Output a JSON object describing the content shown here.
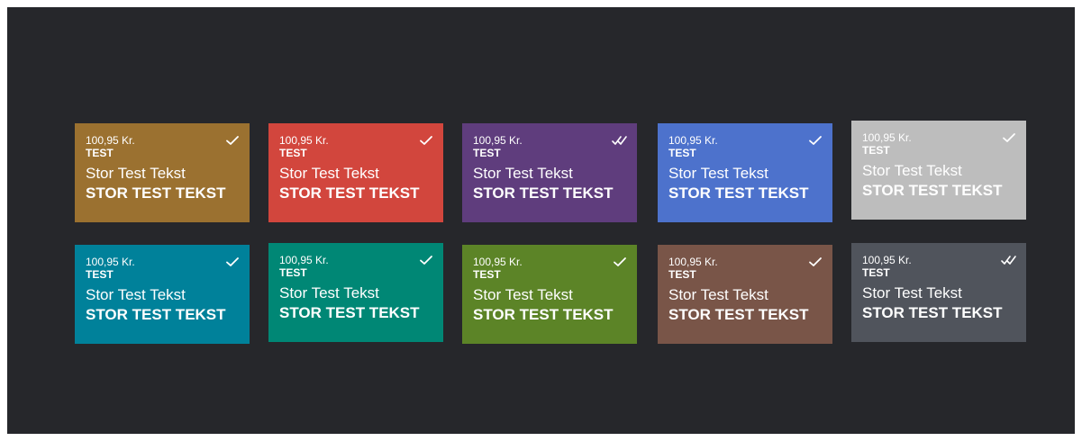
{
  "cards": [
    {
      "price": "100,95 Kr.",
      "label": "TEST",
      "text": "Stor Test Tekst",
      "text_bold": "STOR TEST TEKST",
      "color": "#9b7130",
      "icon": "check-icon"
    },
    {
      "price": "100,95 Kr.",
      "label": "TEST",
      "text": "Stor Test Tekst",
      "text_bold": "STOR TEST TEKST",
      "color": "#d2463d",
      "icon": "check-icon"
    },
    {
      "price": "100,95 Kr.",
      "label": "TEST",
      "text": "Stor Test Tekst",
      "text_bold": "STOR TEST TEKST",
      "color": "#5f3d7d",
      "icon": "double-check-icon"
    },
    {
      "price": "100,95 Kr.",
      "label": "TEST",
      "text": "Stor Test Tekst",
      "text_bold": "STOR TEST TEKST",
      "color": "#4d72cc",
      "icon": "check-icon"
    },
    {
      "price": "100,95 Kr.",
      "label": "TEST",
      "text": "Stor Test Tekst",
      "text_bold": "STOR TEST TEKST",
      "color": "#bdbdbd",
      "icon": "check-icon"
    },
    {
      "price": "100,95 Kr.",
      "label": "TEST",
      "text": "Stor Test Tekst",
      "text_bold": "STOR TEST TEKST",
      "color": "#00819a",
      "icon": "check-icon"
    },
    {
      "price": "100,95 Kr.",
      "label": "TEST",
      "text": "Stor Test Tekst",
      "text_bold": "STOR TEST TEKST",
      "color": "#008775",
      "icon": "check-icon"
    },
    {
      "price": "100,95 Kr.",
      "label": "TEST",
      "text": "Stor Test Tekst",
      "text_bold": "STOR TEST TEKST",
      "color": "#5c8427",
      "icon": "check-icon"
    },
    {
      "price": "100,95 Kr.",
      "label": "TEST",
      "text": "Stor Test Tekst",
      "text_bold": "STOR TEST TEKST",
      "color": "#795548",
      "icon": "check-icon"
    },
    {
      "price": "100,95 Kr.",
      "label": "TEST",
      "text": "Stor Test Tekst",
      "text_bold": "STOR TEST TEKST",
      "color": "#50545c",
      "icon": "double-check-icon"
    }
  ]
}
